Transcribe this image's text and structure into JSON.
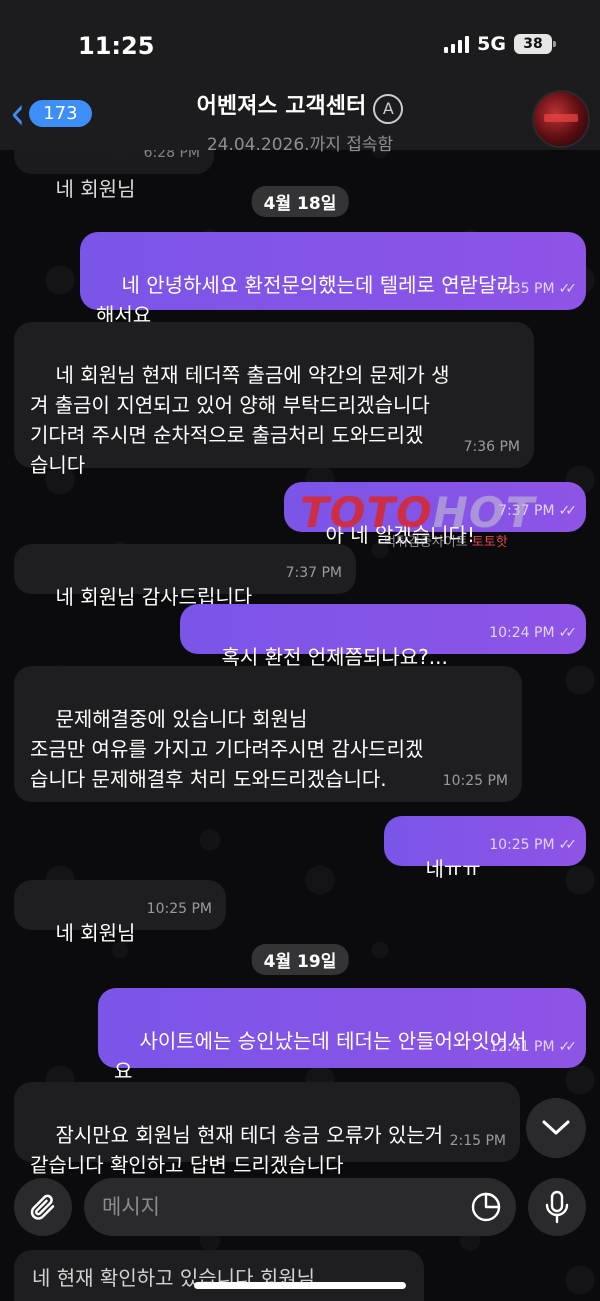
{
  "status": {
    "time": "11:25",
    "network": "5G",
    "battery": "38"
  },
  "header": {
    "back_count": "173",
    "title": "어벤져스 고객센터",
    "subtitle": "24.04.2026.까지 접속함"
  },
  "messages": {
    "prev_partial": {
      "text": "네 회원님",
      "time": "6:28 PM"
    },
    "date1": "4월 18일",
    "m1": {
      "text": "네 안녕하세요 환전문의했는데 텔레로 연랃달라\n해서요",
      "time": "7:35 PM"
    },
    "m2": {
      "text": "네 회원님 현재 테더쪽 출금에 약간의 문제가 생\n겨 출금이 지연되고 있어 양해 부탁드리겠습니다\n기다려 주시면 순차적으로 출금처리 도와드리겠\n습니다",
      "time": "7:36 PM"
    },
    "m3": {
      "text": "아 네 알겠습니다!",
      "time": "7:37 PM"
    },
    "m4": {
      "text": "네 회원님 감사드립니다",
      "time": "7:37 PM"
    },
    "m5": {
      "text": "혹시 환전 언제쯤되나요?...",
      "time": "10:24 PM"
    },
    "m6": {
      "text": "문제해결중에 있습니다 회원님\n조금만 여유를 가지고 기다려주시면 감사드리겠\n습니다 문제해결후 처리 도와드리겠습니다.",
      "time": "10:25 PM"
    },
    "m7": {
      "text": "네ㅠㅠ",
      "time": "10:25 PM"
    },
    "m8": {
      "text": "네 회원님",
      "time": "10:25 PM"
    },
    "date2": "4월 19일",
    "m9": {
      "text": "사이트에는 승인났는데 테더는 안들어와잇어서\n요",
      "time": "12:41 PM"
    },
    "m10": {
      "text": "잠시만요 회원님 현재 테더 송금 오류가 있는거\n같습니다 확인하고 답변 드리겠습니다",
      "time": "2:15 PM"
    },
    "m11_partial": {
      "text": "네 현재 확인하고 있습니다 회원님"
    }
  },
  "watermark": {
    "logo_a": "TOTO",
    "logo_b": "HOT",
    "sub": "먹튀검증사이트",
    "sub_accent": "토토핫"
  },
  "composer": {
    "placeholder": "메시지"
  }
}
